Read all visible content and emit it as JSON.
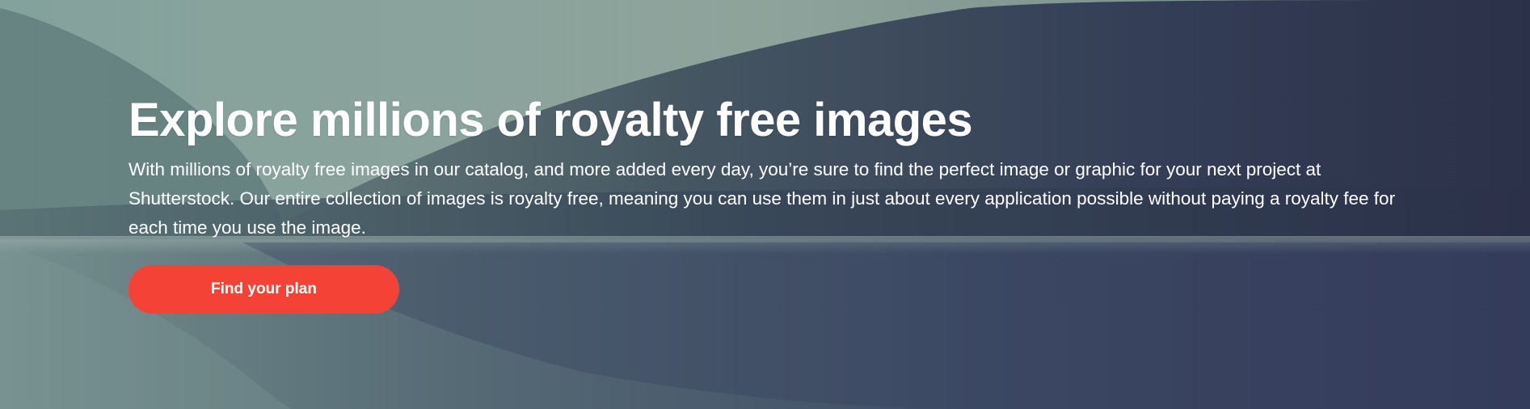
{
  "hero": {
    "title": "Explore millions of royalty free images",
    "description": "With millions of royalty free images in our catalog, and more added every day, you’re sure to find the perfect image or graphic for your next project at Shutterstock. Our entire collection of images is royalty free, meaning you can use them in just about every application possible without paying a royalty fee for each time you use the image.",
    "cta_label": "Find your plan",
    "background_image": "misty-forest-lake-icon"
  },
  "colors": {
    "cta_background": "#f44336",
    "text": "#ffffff",
    "sky": "#9fb7ae",
    "forest": "#35405a",
    "water": "#4a5a72"
  }
}
